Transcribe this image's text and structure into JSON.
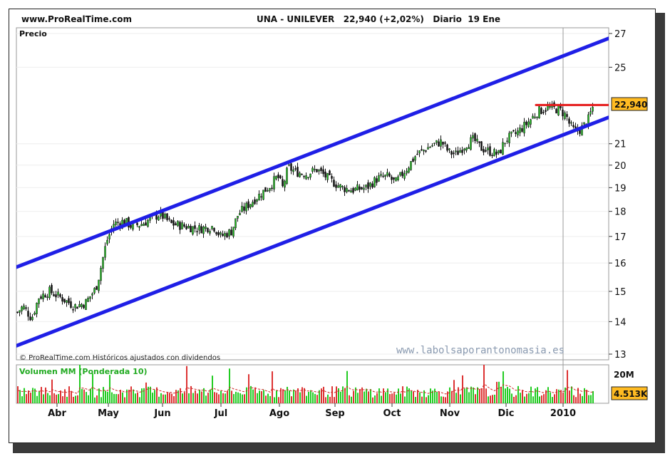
{
  "header": {
    "site": "www.ProRealTime.com",
    "title": "UNA - UNILEVER   22,940 (+2,02%)   Diario  19 Ene"
  },
  "price_panel": {
    "label": "Precio",
    "credit": "© ProRealTime.com Históricos ajustados con dividendos",
    "watermark": "www.labolsaporantonomasia.es",
    "last_price_label": "22,940"
  },
  "volume_panel": {
    "label": "Volumen MM (Ponderada 10)",
    "max_label": "20M",
    "last_label": "4.513K"
  },
  "colors": {
    "channel": "#1f1fe6",
    "resistance": "#e51b1b",
    "candle_up": "#20c020",
    "candle_down": "#111111",
    "vol_up": "#22cc22",
    "vol_down": "#dd3333",
    "ma": "#cc2222",
    "label_box": "#ffbb22"
  },
  "chart_data": [
    {
      "type": "candlestick",
      "scale": "log",
      "x_axis_labels": [
        "Abr",
        "May",
        "Jun",
        "Jul",
        "Ago",
        "Sep",
        "Oct",
        "Nov",
        "Dic",
        "2010"
      ],
      "y_ticks": [
        13,
        14,
        15,
        16,
        17,
        18,
        19,
        20,
        21,
        22.94,
        25,
        27
      ],
      "y_tick_labels": [
        "13",
        "14",
        "15",
        "16",
        "17",
        "18",
        "19",
        "20",
        "21",
        "22,940",
        "25",
        "27"
      ],
      "ylim": [
        12.75,
        27.4
      ],
      "close_path": [
        [
          0,
          14.3
        ],
        [
          8,
          14.5
        ],
        [
          20,
          14.1
        ],
        [
          30,
          14.8
        ],
        [
          45,
          15.0
        ],
        [
          60,
          14.8
        ],
        [
          80,
          14.5
        ],
        [
          95,
          14.6
        ],
        [
          110,
          15.1
        ],
        [
          115,
          15.6
        ],
        [
          125,
          16.8
        ],
        [
          135,
          17.5
        ],
        [
          150,
          17.6
        ],
        [
          160,
          17.4
        ],
        [
          175,
          17.5
        ],
        [
          188,
          17.7
        ],
        [
          200,
          17.9
        ],
        [
          215,
          17.5
        ],
        [
          235,
          17.4
        ],
        [
          255,
          17.3
        ],
        [
          275,
          17.4
        ],
        [
          285,
          17.0
        ],
        [
          300,
          17.2
        ],
        [
          310,
          17.9
        ],
        [
          325,
          18.3
        ],
        [
          340,
          18.7
        ],
        [
          355,
          19.1
        ],
        [
          365,
          19.5
        ],
        [
          372,
          19.0
        ],
        [
          380,
          19.9
        ],
        [
          390,
          19.7
        ],
        [
          405,
          19.6
        ],
        [
          420,
          19.8
        ],
        [
          440,
          19.3
        ],
        [
          455,
          19.0
        ],
        [
          470,
          18.9
        ],
        [
          490,
          19.0
        ],
        [
          505,
          19.4
        ],
        [
          520,
          19.5
        ],
        [
          530,
          19.2
        ],
        [
          545,
          19.8
        ],
        [
          560,
          20.5
        ],
        [
          580,
          20.9
        ],
        [
          595,
          21.1
        ],
        [
          605,
          20.6
        ],
        [
          615,
          20.5
        ],
        [
          630,
          21.0
        ],
        [
          640,
          21.2
        ],
        [
          650,
          20.8
        ],
        [
          665,
          20.6
        ],
        [
          675,
          20.5
        ],
        [
          685,
          21.2
        ],
        [
          700,
          21.5
        ],
        [
          715,
          22.0
        ],
        [
          730,
          22.6
        ],
        [
          745,
          22.8
        ],
        [
          760,
          22.7
        ],
        [
          770,
          22.4
        ],
        [
          775,
          21.9
        ],
        [
          782,
          21.6
        ],
        [
          790,
          21.7
        ],
        [
          800,
          22.1
        ],
        [
          808,
          22.94
        ]
      ],
      "channel_upper": {
        "start": {
          "x": 0,
          "y": 15.85
        },
        "end": {
          "x": 831,
          "y": 26.7
        }
      },
      "channel_lower": {
        "start": {
          "x": 0,
          "y": 13.25
        },
        "end": {
          "x": 831,
          "y": 22.3
        }
      },
      "resistance": {
        "start": {
          "x": 729,
          "y": 22.94
        },
        "end": {
          "x": 831,
          "y": 22.94
        }
      }
    },
    {
      "type": "bar",
      "title": "Volumen MM (Ponderada 10)",
      "ylim": [
        0,
        20
      ],
      "y_tick_labels": [
        "20M"
      ],
      "last_value_label": "4.513K"
    }
  ]
}
